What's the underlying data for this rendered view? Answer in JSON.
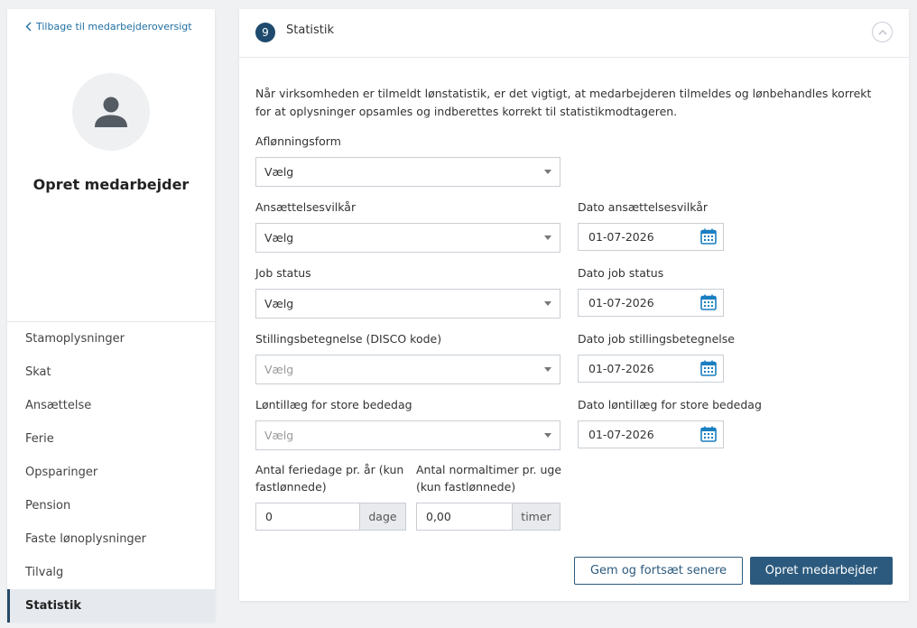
{
  "sidebar": {
    "back_label": "Tilbage til medarbejderoversigt",
    "title": "Opret medarbejder",
    "items": [
      {
        "label": "Stamoplysninger"
      },
      {
        "label": "Skat"
      },
      {
        "label": "Ansættelse"
      },
      {
        "label": "Ferie"
      },
      {
        "label": "Opsparinger"
      },
      {
        "label": "Pension"
      },
      {
        "label": "Faste lønoplysninger"
      },
      {
        "label": "Tilvalg"
      },
      {
        "label": "Statistik",
        "active": true
      }
    ]
  },
  "section": {
    "step_number": "9",
    "title": "Statistik",
    "intro": "Når virksomheden er tilmeldt lønstatistik, er det vigtigt, at medarbejderen tilmeldes og lønbehandles korrekt for at oplysninger opsamles og indberettes korrekt til statistikmodtageren."
  },
  "form": {
    "aflonningsform": {
      "label": "Aflønningsform",
      "value": "Vælg"
    },
    "ansaettelsesvilkaar": {
      "label": "Ansættelsesvilkår",
      "value": "Vælg"
    },
    "dato_ansaettelsesvilkaar": {
      "label": "Dato ansættelsesvilkår",
      "value": "01-07-2026"
    },
    "job_status": {
      "label": "Job status",
      "value": "Vælg"
    },
    "dato_job_status": {
      "label": "Dato job status",
      "value": "01-07-2026"
    },
    "stillingsbetegnelse": {
      "label": "Stillingsbetegnelse (DISCO kode)",
      "value": "Vælg"
    },
    "dato_stillingsbetegnelse": {
      "label": "Dato job stillingsbetegnelse",
      "value": "01-07-2026"
    },
    "lontillaeg": {
      "label": "Løntillæg for store bededag",
      "value": "Vælg"
    },
    "dato_lontillaeg": {
      "label": "Dato løntillæg for store bededag",
      "value": "01-07-2026"
    },
    "feriedage": {
      "label_line1": "Antal feriedage pr. år (kun",
      "label_line2": "fastlønnede)",
      "value": "0",
      "unit": "dage"
    },
    "normaltimer": {
      "label_line1": "Antal normaltimer pr. uge",
      "label_line2": "(kun fastlønnede)",
      "value": "0,00",
      "unit": "timer"
    }
  },
  "actions": {
    "save_later_label": "Gem og fortsæt senere",
    "create_label": "Opret medarbejder"
  },
  "colors": {
    "primary": "#2c5a7e",
    "badge": "#1f4a6e",
    "link": "#1f6fa3",
    "calendar_icon": "#1a7fc1"
  }
}
